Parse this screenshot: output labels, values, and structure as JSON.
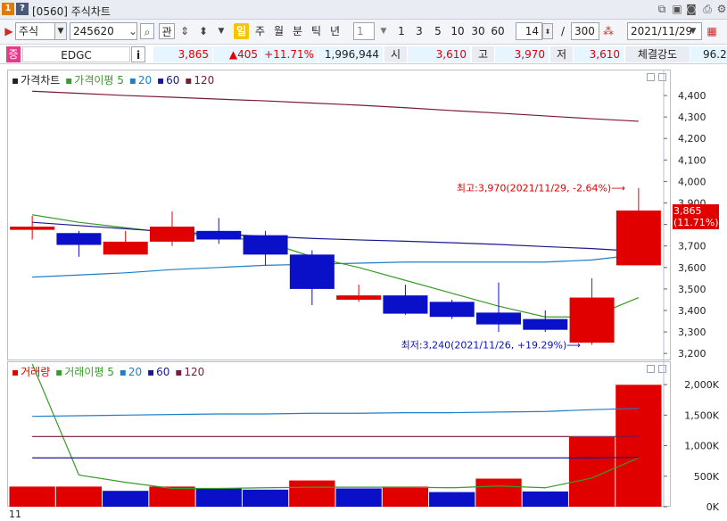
{
  "window": {
    "num_badge": "1",
    "help_badge": "?",
    "title": "[0560] 주식차트"
  },
  "toolbar": {
    "market_select": "주식",
    "code": "245620",
    "search_icon": "search-icon",
    "btn_gwan": "관",
    "period_buttons": [
      "일",
      "주",
      "월",
      "분",
      "틱",
      "년"
    ],
    "selected_period": "일",
    "unit_select": "1",
    "numbers": [
      "1",
      "3",
      "5",
      "10",
      "30",
      "60"
    ],
    "count_value": "14",
    "count_total": "300",
    "slash": "/",
    "date_value": "2021/11/29"
  },
  "quote": {
    "badge": "증",
    "name": "EDGC",
    "info_button": "i",
    "price": "3,865",
    "change": "▲405",
    "change_pct": "+11.71%",
    "volume": "1,996,944",
    "open_label": "시",
    "open": "3,610",
    "high_label": "고",
    "high": "3,970",
    "low_label": "저",
    "low": "3,610",
    "strength_label": "체결강도",
    "strength": "96.2"
  },
  "price_panel": {
    "legend": [
      {
        "text": "가격차트",
        "color": "#222222"
      },
      {
        "text": "가격이평 5",
        "color": "#3a9a2a"
      },
      {
        "text": "20",
        "color": "#1e7ec8"
      },
      {
        "text": "60",
        "color": "#1a1a8c"
      },
      {
        "text": "120",
        "color": "#7a1a3a"
      }
    ],
    "high_annotation": "최고:3,970(2021/11/29, -2.64%)⟶",
    "low_annotation": "최저:3,240(2021/11/26, +19.29%)⟶",
    "current_price_label": "3,865",
    "current_pct_label": "(11.71%)"
  },
  "volume_panel": {
    "legend": [
      {
        "text": "거래량",
        "color": "#e00000"
      },
      {
        "text": "거래이평 5",
        "color": "#3a9a2a"
      },
      {
        "text": "20",
        "color": "#1e7ec8"
      },
      {
        "text": "60",
        "color": "#1a1a8c"
      },
      {
        "text": "120",
        "color": "#7a1a3a"
      }
    ]
  },
  "chart_data": [
    {
      "type": "candlestick",
      "yticks": [
        "4,400",
        "4,300",
        "4,200",
        "4,100",
        "4,000",
        "3,900",
        "3,800",
        "3,700",
        "3,600",
        "3,500",
        "3,400",
        "3,300",
        "3,200"
      ],
      "ylim": [
        3180,
        4450
      ],
      "candles": [
        {
          "open": 3790,
          "close": 3775,
          "high": 3840,
          "low": 3730,
          "dir": "up"
        },
        {
          "open": 3760,
          "close": 3705,
          "high": 3770,
          "low": 3650,
          "dir": "down"
        },
        {
          "open": 3660,
          "close": 3720,
          "high": 3770,
          "low": 3660,
          "dir": "up"
        },
        {
          "open": 3720,
          "close": 3790,
          "high": 3860,
          "low": 3700,
          "dir": "up"
        },
        {
          "open": 3770,
          "close": 3730,
          "high": 3830,
          "low": 3710,
          "dir": "down"
        },
        {
          "open": 3750,
          "close": 3660,
          "high": 3770,
          "low": 3610,
          "dir": "down"
        },
        {
          "open": 3660,
          "close": 3500,
          "high": 3680,
          "low": 3425,
          "dir": "down"
        },
        {
          "open": 3450,
          "close": 3470,
          "high": 3520,
          "low": 3440,
          "dir": "up"
        },
        {
          "open": 3470,
          "close": 3385,
          "high": 3520,
          "low": 3380,
          "dir": "down"
        },
        {
          "open": 3440,
          "close": 3370,
          "high": 3450,
          "low": 3360,
          "dir": "down"
        },
        {
          "open": 3390,
          "close": 3335,
          "high": 3530,
          "low": 3300,
          "dir": "down"
        },
        {
          "open": 3360,
          "close": 3310,
          "high": 3400,
          "low": 3300,
          "dir": "down"
        },
        {
          "open": 3250,
          "close": 3460,
          "high": 3550,
          "low": 3240,
          "dir": "up"
        },
        {
          "open": 3610,
          "close": 3865,
          "high": 3970,
          "low": 3610,
          "dir": "up"
        }
      ],
      "ma": {
        "5": [
          3845,
          3810,
          3785,
          3760,
          3745,
          3720,
          3650,
          3600,
          3540,
          3480,
          3420,
          3370,
          3370,
          3460
        ],
        "20": [
          3555,
          3565,
          3575,
          3590,
          3600,
          3610,
          3615,
          3620,
          3625,
          3625,
          3625,
          3625,
          3635,
          3660
        ],
        "60": [
          3810,
          3795,
          3780,
          3765,
          3755,
          3745,
          3735,
          3728,
          3722,
          3715,
          3707,
          3697,
          3688,
          3675
        ],
        "120": [
          4420,
          4410,
          4400,
          4392,
          4383,
          4375,
          4365,
          4355,
          4343,
          4330,
          4318,
          4305,
          4292,
          4280
        ]
      }
    },
    {
      "type": "bar",
      "yticks": [
        "2,000K",
        "1,500K",
        "1,000K",
        "500K",
        "0K"
      ],
      "ylim": [
        0,
        2250000
      ],
      "values": [
        330000,
        330000,
        260000,
        330000,
        300000,
        280000,
        430000,
        300000,
        330000,
        240000,
        460000,
        250000,
        1140000,
        1996944
      ],
      "dir": [
        "up",
        "up",
        "down",
        "up",
        "down",
        "down",
        "up",
        "down",
        "up",
        "down",
        "up",
        "down",
        "up",
        "up"
      ],
      "ma": {
        "5": [
          2340000,
          520000,
          400000,
          300000,
          300000,
          310000,
          320000,
          320000,
          320000,
          310000,
          340000,
          310000,
          470000,
          800000
        ],
        "20": [
          1480000,
          1490000,
          1500000,
          1510000,
          1520000,
          1520000,
          1530000,
          1530000,
          1540000,
          1540000,
          1550000,
          1560000,
          1590000,
          1610000
        ],
        "60": [
          800000,
          800000,
          800000,
          800000,
          800000,
          800000,
          800000,
          800000,
          800000,
          800000,
          800000,
          800000,
          800000,
          810000
        ],
        "120": [
          1150000,
          1150000,
          1150000,
          1150000,
          1150000,
          1150000,
          1150000,
          1150000,
          1150000,
          1150000,
          1150000,
          1150000,
          1150000,
          1150000
        ]
      }
    }
  ],
  "colors": {
    "up": "#e00000",
    "down": "#0a10c8",
    "ma5": "#3a9a2a",
    "ma20": "#1e7ec8",
    "ma60": "#1a1a8c",
    "ma120": "#7a1a3a"
  },
  "bottom_label": "11"
}
